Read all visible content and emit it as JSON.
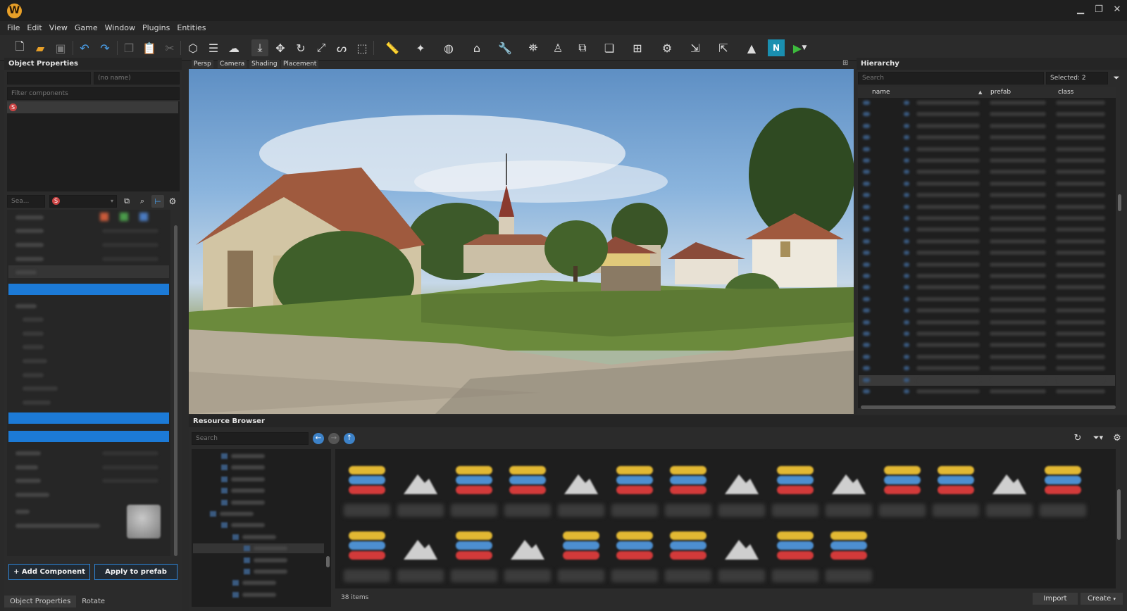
{
  "app": {
    "logo": "W",
    "controls": {
      "min": "▁",
      "restore": "❐",
      "close": "✕"
    }
  },
  "menu": [
    "File",
    "Edit",
    "View",
    "Game",
    "Window",
    "Plugins",
    "Entities"
  ],
  "toolbar": {
    "icons": [
      "new-file-icon",
      "open-folder-icon",
      "save-icon",
      "undo-icon",
      "redo-icon",
      "copy-icon",
      "paste-icon",
      "cut-icon",
      "cube-icon",
      "layers-icon",
      "weather-icon",
      "terrain-place-icon",
      "move-icon",
      "rotate-icon",
      "scale-icon",
      "spline-icon",
      "select-box-icon",
      "measure-icon",
      "magic-wand-icon",
      "globe-icon",
      "gamepad-icon",
      "wrench-icon",
      "map-icon",
      "character-icon",
      "transform-icon",
      "prefab-icon",
      "hierarchy-icon",
      "settings-gears-icon",
      "import-icon",
      "export-icon",
      "mountain-icon",
      "navmesh-icon",
      "play-icon"
    ]
  },
  "object_properties": {
    "title": "Object Properties",
    "name_placeholder": "(no name)",
    "filter_placeholder": "Filter components",
    "search_placeholder": "Sea...",
    "buttons": {
      "add_component": "+ Add Component",
      "apply_prefab": "Apply to prefab"
    },
    "bottom_tabs": [
      "Object Properties",
      "Rotate"
    ]
  },
  "viewport": {
    "tabs": [
      "Persp",
      "Camera",
      "Shading",
      "Placement"
    ]
  },
  "hierarchy": {
    "title": "Hierarchy",
    "search_placeholder": "Search",
    "selected": "Selected: 2",
    "columns": [
      "name",
      "prefab",
      "class"
    ]
  },
  "resource_browser": {
    "title": "Resource Browser",
    "search_placeholder": "Search",
    "item_count": "38 items",
    "buttons": {
      "import": "Import",
      "create": "Create"
    }
  },
  "colors": {
    "accent": "#1c7ad6",
    "stripe_yellow": "#e2b833",
    "stripe_blue": "#4d8fd0",
    "stripe_red": "#d23a3a",
    "sky": "#8ab4dd",
    "grass": "#5d7a34"
  }
}
